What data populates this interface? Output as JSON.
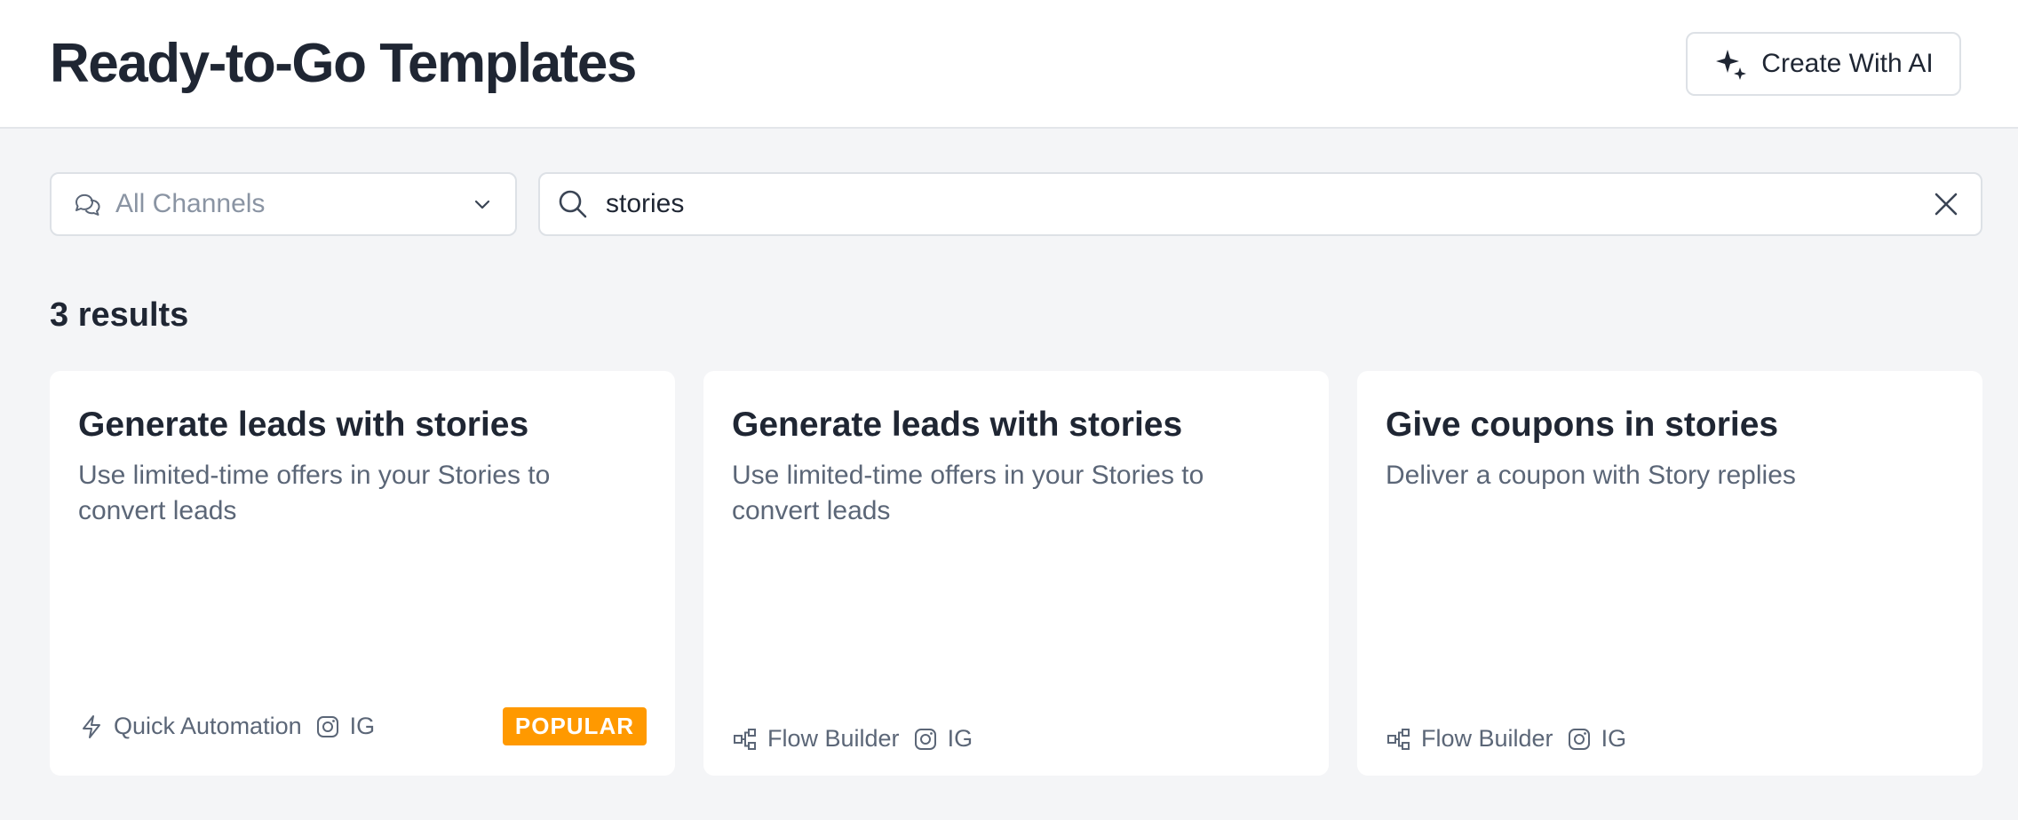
{
  "header": {
    "title": "Ready-to-Go Templates",
    "create_ai_label": "Create With AI"
  },
  "filters": {
    "channel_value": "All Channels",
    "search_value": "stories"
  },
  "results": {
    "count_label": "3 results"
  },
  "cards": [
    {
      "title": "Generate leads with stories",
      "description": "Use limited-time offers in your Stories to convert leads",
      "type_label": "Quick Automation",
      "type_icon": "lightning-icon",
      "channel_label": "IG",
      "channel_icon": "instagram-icon",
      "badge": "POPULAR"
    },
    {
      "title": "Generate leads with stories",
      "description": "Use limited-time offers in your Stories to convert leads",
      "type_label": "Flow Builder",
      "type_icon": "flow-builder-icon",
      "channel_label": "IG",
      "channel_icon": "instagram-icon"
    },
    {
      "title": "Give coupons in stories",
      "description": "Deliver a coupon with Story replies",
      "type_label": "Flow Builder",
      "type_icon": "flow-builder-icon",
      "channel_label": "IG",
      "channel_icon": "instagram-icon"
    }
  ],
  "colors": {
    "badge": "#ff9900",
    "background": "#f4f5f7",
    "text_primary": "#1f2633",
    "text_secondary": "#5b6677"
  }
}
